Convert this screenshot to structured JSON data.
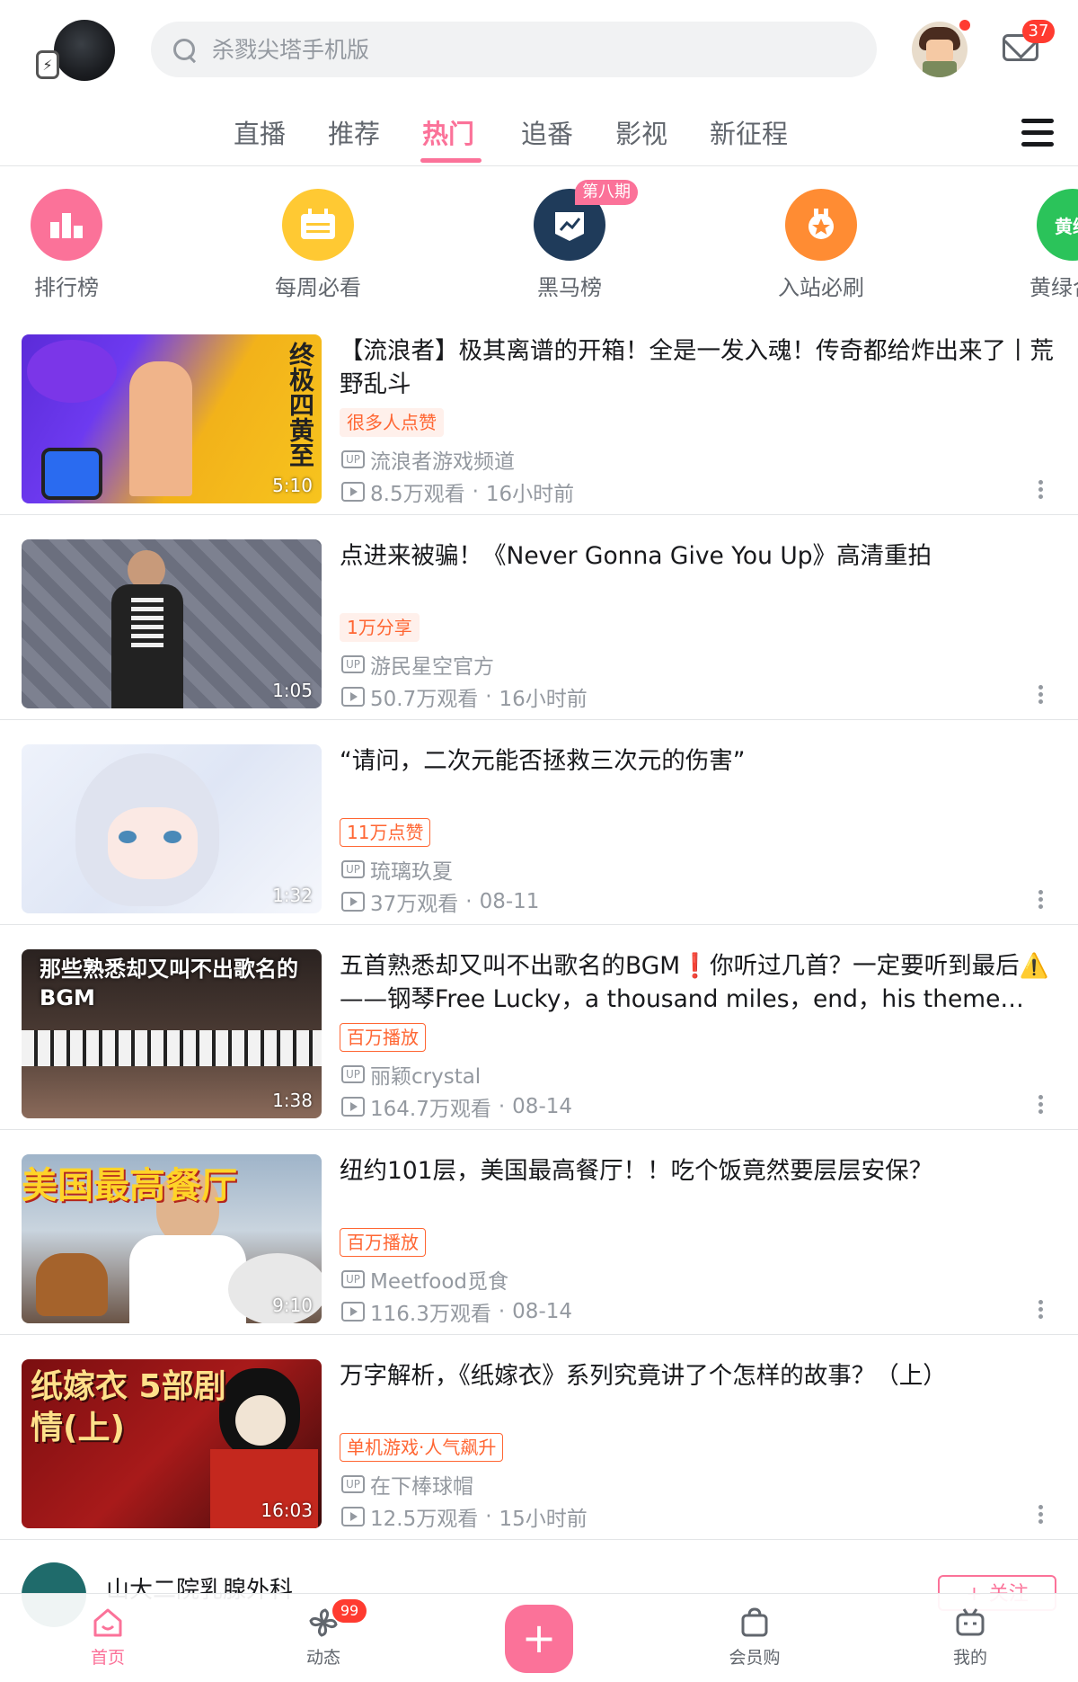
{
  "header": {
    "search_placeholder": "杀戮尖塔手机版",
    "mail_count": "37"
  },
  "tabs": [
    {
      "label": "直播",
      "active": false
    },
    {
      "label": "推荐",
      "active": false
    },
    {
      "label": "热门",
      "active": true
    },
    {
      "label": "追番",
      "active": false
    },
    {
      "label": "影视",
      "active": false
    },
    {
      "label": "新征程",
      "active": false
    }
  ],
  "quick_entries": [
    {
      "label": "排行榜",
      "color": "#fb7299",
      "icon": "bar-chart-icon"
    },
    {
      "label": "每周必看",
      "color": "#ffc933",
      "icon": "calendar-icon"
    },
    {
      "label": "黑马榜",
      "color": "#1f3b5a",
      "icon": "trend-icon",
      "badge": "第八期"
    },
    {
      "label": "入站必刷",
      "color": "#ff8c33",
      "icon": "medal-icon"
    },
    {
      "label": "黄绿合战",
      "color": "#2bc35a",
      "icon": "text-icon"
    }
  ],
  "videos": [
    {
      "title": "【流浪者】极其离谱的开箱！全是一发入魂！传奇都给炸出来了丨荒野乱斗",
      "tag": "很多人点赞",
      "tag_style": "fill",
      "up": "流浪者游戏频道",
      "views": "8.5万观看",
      "time": "16小时前",
      "duration": "5:10",
      "thumb_text": "终极四黄至"
    },
    {
      "title": "点进来被骗！《Never Gonna Give You Up》高清重拍",
      "tag": "1万分享",
      "tag_style": "fill",
      "up": "游民星空官方",
      "views": "50.7万观看",
      "time": "16小时前",
      "duration": "1:05",
      "thumb_text": ""
    },
    {
      "title": "“请问，二次元能否拯救三次元的伤害”",
      "tag": "11万点赞",
      "tag_style": "line",
      "up": "琉璃玖夏",
      "views": "37万观看",
      "time": "08-11",
      "duration": "1:32",
      "thumb_text": ""
    },
    {
      "title": "五首熟悉却又叫不出歌名的BGM❗你听过几首？一定要听到最后⚠️——钢琴Free Lucky，a thousand miles，end，his theme…",
      "tag": "百万播放",
      "tag_style": "line",
      "up": "丽颖crystal",
      "views": "164.7万观看",
      "time": "08-14",
      "duration": "1:38",
      "thumb_text": "那些熟悉却又叫不出歌名的BGM"
    },
    {
      "title": "纽约101层，美国最高餐厅！！吃个饭竟然要层层安保？",
      "tag": "百万播放",
      "tag_style": "line",
      "up": "Meetfood觅食",
      "views": "116.3万观看",
      "time": "08-14",
      "duration": "9:10",
      "thumb_text": "美国最高餐厅"
    },
    {
      "title": "万字解析，《纸嫁衣》系列究竟讲了个怎样的故事？（上）",
      "tag": "单机游戏·人气飙升",
      "tag_style": "line",
      "up": "在下棒球帽",
      "views": "12.5万观看",
      "time": "15小时前",
      "duration": "16:03",
      "thumb_text": "纸嫁衣 5部剧情(上)"
    }
  ],
  "partial_card": {
    "title": "山大二院乳腺外科",
    "follow_label": "+ 关注"
  },
  "bottom_nav": [
    {
      "label": "首页",
      "active": true
    },
    {
      "label": "动态",
      "active": false,
      "badge": "99"
    },
    {
      "label": "",
      "active": false
    },
    {
      "label": "会员购",
      "active": false
    },
    {
      "label": "我的",
      "active": false
    }
  ]
}
